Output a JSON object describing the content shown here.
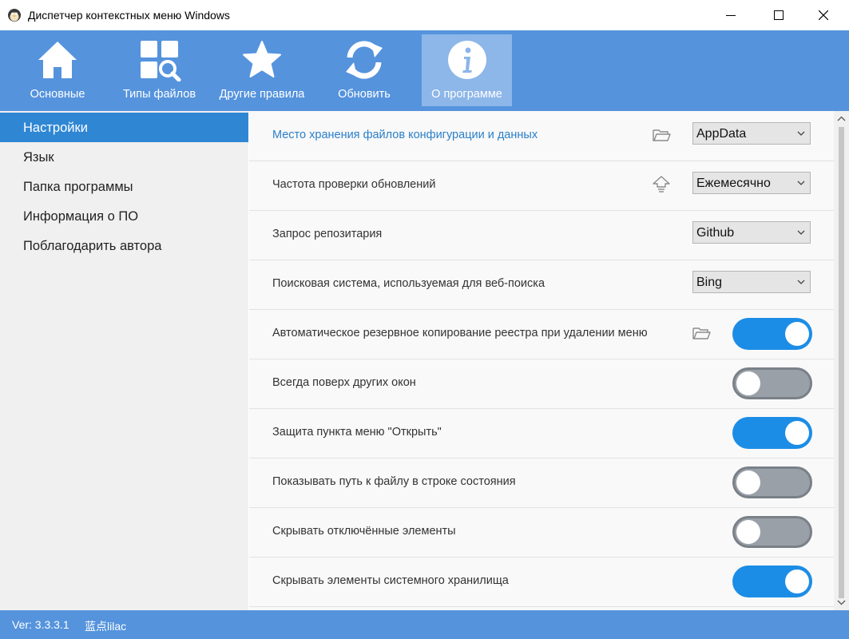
{
  "window": {
    "title": "Диспетчер контекстных меню Windows",
    "app_icon": "penguin-icon",
    "controls": [
      "minimize-icon",
      "maximize-icon",
      "close-icon"
    ]
  },
  "colors": {
    "toolbar": "#5593dd",
    "toolbar_active": "#8db6e9",
    "sidebar_active": "#2f87d4",
    "toggle_on": "#1c8de6",
    "toggle_off": "#9aa0a8",
    "link": "#2a7fc9"
  },
  "toolbar": {
    "items": [
      {
        "label": "Основные",
        "icon": "home-icon"
      },
      {
        "label": "Типы файлов",
        "icon": "file-types-search-icon"
      },
      {
        "label": "Другие правила",
        "icon": "star-icon"
      },
      {
        "label": "Обновить",
        "icon": "refresh-icon"
      },
      {
        "label": "О программе",
        "icon": "info-icon",
        "active": true
      }
    ]
  },
  "sidebar": {
    "items": [
      {
        "label": "Настройки",
        "active": true
      },
      {
        "label": "Язык"
      },
      {
        "label": "Папка программы"
      },
      {
        "label": "Информация о ПО"
      },
      {
        "label": "Поблагодарить автора"
      }
    ]
  },
  "settings": {
    "rows": [
      {
        "label": "Место хранения файлов конфигурации и данных",
        "icon": "folder-open-icon",
        "select": "AppData"
      },
      {
        "label": "Частота проверки обновлений",
        "icon": "update-check-icon",
        "select": "Ежемесячно"
      },
      {
        "label": "Запрос репозитария",
        "select": "Github"
      },
      {
        "label": "Поисковая система, используемая для веб-поиска",
        "select": "Bing"
      },
      {
        "label": "Автоматическое резервное копирование реестра при удалении меню",
        "icon": "folder-open-icon",
        "toggle": true
      },
      {
        "label": "Всегда поверх других окон",
        "toggle": false
      },
      {
        "label": "Защита пункта меню \"Открыть\"",
        "toggle": true
      },
      {
        "label": "Показывать путь к файлу в строке состояния",
        "toggle": false
      },
      {
        "label": "Скрывать отключённые элементы",
        "toggle": false
      },
      {
        "label": "Скрывать элементы системного хранилища",
        "toggle": true
      }
    ]
  },
  "statusbar": {
    "version": "Ver:  3.3.3.1",
    "author": "蓝点lilac"
  }
}
